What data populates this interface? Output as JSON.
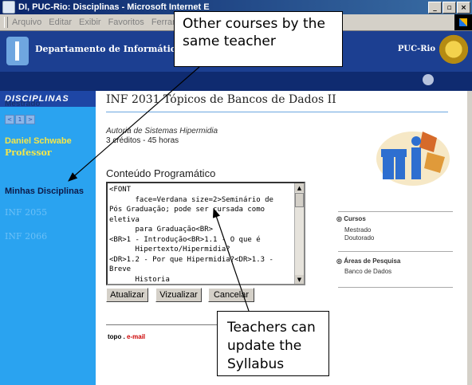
{
  "window": {
    "title": "DI, PUC-Rio: Disciplinas - Microsoft Internet E",
    "menu": [
      "Arquivo",
      "Editar",
      "Exibir",
      "Favoritos",
      "Ferramentas"
    ]
  },
  "header": {
    "department": "Departamento de Informática",
    "university": "PUC-Rio"
  },
  "sidebar": {
    "section": "DISCIPLINAS",
    "program": "Mestrado",
    "teacher_name": "Daniel Schwabe",
    "teacher_role": "Professor",
    "my_courses": "Minhas Disciplinas",
    "courses": [
      "INF 2055",
      "INF 2066"
    ]
  },
  "course": {
    "title": "INF 2031 Tópicos de Bancos de Dados II",
    "authoring": "Autoria de Sistemas Hipermidia",
    "credits": "3 créditos - 45 horas",
    "syllabus_heading": "Conteúdo Programático",
    "syllabus_text": "<FONT\n      face=Verdana size=2>Seminário de\nPós Graduação; pode ser cursada como\neletiva\n      para Graduação<BR>\n<BR>1 - Introdução<BR>1.1 - O que é\n      Hipertexto/Hipermidia?\n<DR>1.2 - Por que Hipermidia?<DR>1.3 -\nBreve\n      Historia"
  },
  "buttons": {
    "update": "Atualizar",
    "view": "Vizualizar",
    "cancel": "Cancelar"
  },
  "right_panel": {
    "courses_heading": "Cursos",
    "course_items": [
      "Mestrado",
      "Doutorado"
    ],
    "research_heading": "Áreas de Pesquisa",
    "research_items": [
      "Banco de Dados"
    ]
  },
  "footer": {
    "top": "topo",
    "separator": ".",
    "email": "e-mail"
  },
  "annotations": {
    "other_courses": "Other courses by the same teacher",
    "update_syllabus": "Teachers can update the Syllabus"
  }
}
